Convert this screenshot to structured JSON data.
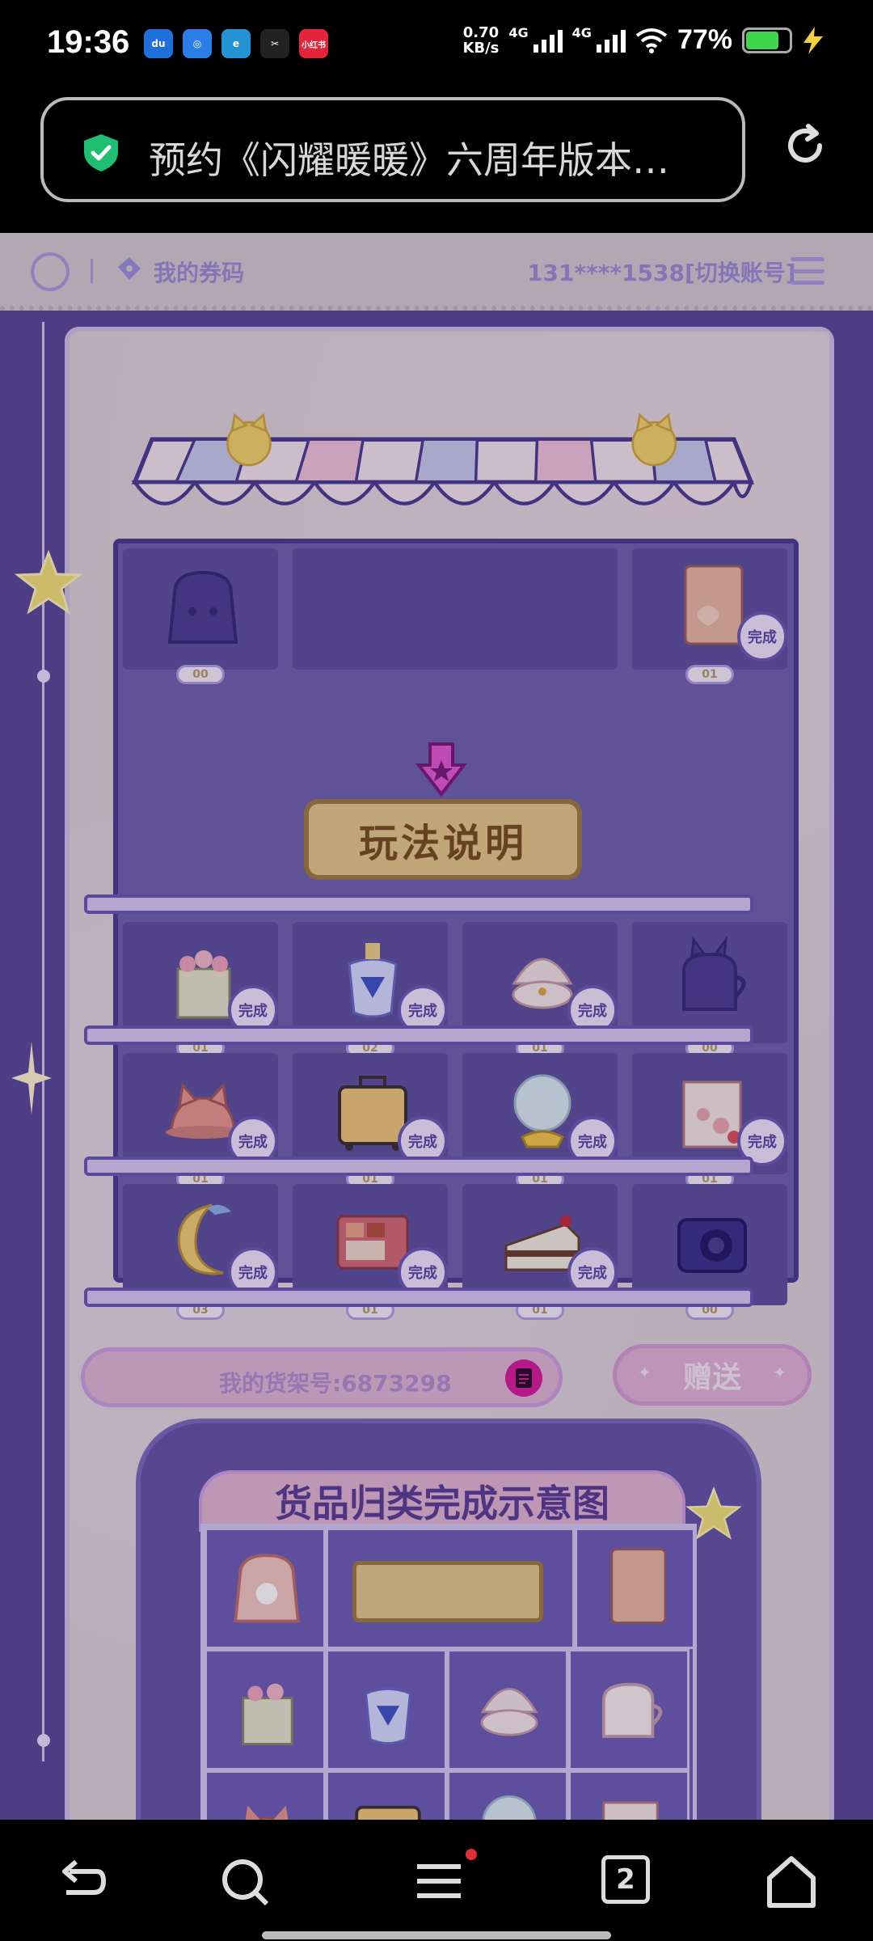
{
  "status_bar": {
    "time": "19:36",
    "apps": [
      "du",
      "",
      "",
      "",
      "小红书"
    ],
    "net_speed_value": "0.70",
    "net_speed_unit": "KB/s",
    "network_1": "4G",
    "network_2": "4G",
    "battery_percent": "77%"
  },
  "browser": {
    "url_title": "预约《闪耀暖暖》六周年版本…",
    "tab_count": "2"
  },
  "site_header": {
    "my_codes_label": "我的券码",
    "account_text": "131****1538[切换账号]"
  },
  "shelf": {
    "howto_label": "玩法说明",
    "done_label": "完成",
    "rows": [
      [
        {
          "name": "bunny-backpack",
          "count": "00",
          "done": false
        },
        {
          "name": "howto-sign",
          "count": "",
          "done": false
        },
        {
          "name": "empty",
          "count": "",
          "done": false
        },
        {
          "name": "photo-album",
          "count": "01",
          "done": true
        }
      ],
      [
        {
          "name": "flower-basket",
          "count": "01",
          "done": true
        },
        {
          "name": "perfume-bottle",
          "count": "02",
          "done": true
        },
        {
          "name": "shell-ring",
          "count": "01",
          "done": true
        },
        {
          "name": "bunny-mug",
          "count": "00",
          "done": false
        }
      ],
      [
        {
          "name": "cat-ear-hat",
          "count": "01",
          "done": true
        },
        {
          "name": "suitcase",
          "count": "01",
          "done": true
        },
        {
          "name": "crystal-ball",
          "count": "01",
          "done": true
        },
        {
          "name": "milk-carton",
          "count": "01",
          "done": true
        }
      ],
      [
        {
          "name": "moon-pillow",
          "count": "03",
          "done": true
        },
        {
          "name": "eyeshadow-palette",
          "count": "01",
          "done": true
        },
        {
          "name": "cake-slice",
          "count": "01",
          "done": true
        },
        {
          "name": "camera",
          "count": "00",
          "done": false
        }
      ]
    ]
  },
  "actions": {
    "shelf_number_label": "我的货架号:6873298",
    "gift_label": "赠送"
  },
  "diagram": {
    "title": "货品归类完成示意图"
  },
  "colors": {
    "accent": "#5a4a9c",
    "done_badge": "#6d5ab8",
    "gift_button": "#e3b2d8"
  }
}
